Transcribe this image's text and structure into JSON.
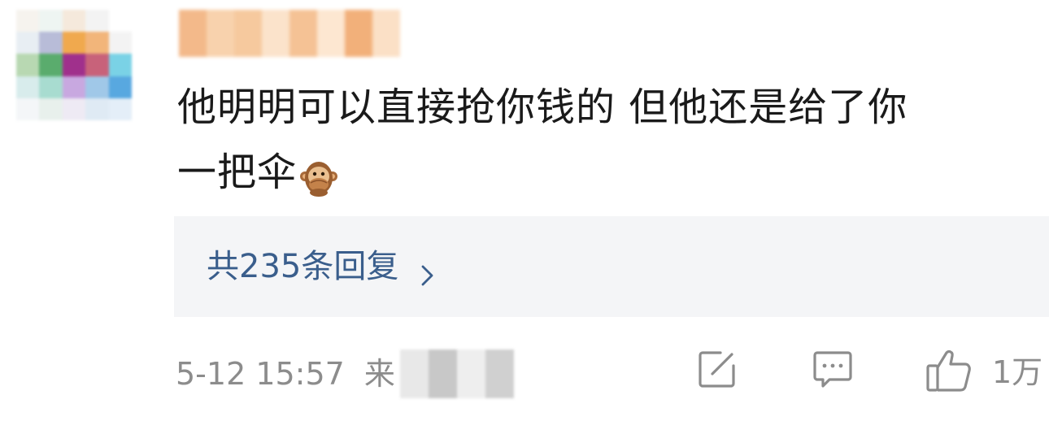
{
  "comment": {
    "text_line1": "他明明可以直接抢你钱的 但他还是给了你",
    "text_line2": "一把伞",
    "emoji": "speak-no-evil-monkey"
  },
  "replies": {
    "label": "共235条回复"
  },
  "footer": {
    "timestamp": "5-12 15:57",
    "source_prefix": "来",
    "like_count": "1万"
  },
  "icons": {
    "share": "share-edit-icon",
    "comment": "comment-icon",
    "like": "thumbs-up-icon",
    "chevron": "chevron-right-icon"
  },
  "colors": {
    "link": "#3a5e8c",
    "meta": "#8c8c8c",
    "text": "#1a1a1a",
    "reply_bg": "#f4f5f7"
  }
}
